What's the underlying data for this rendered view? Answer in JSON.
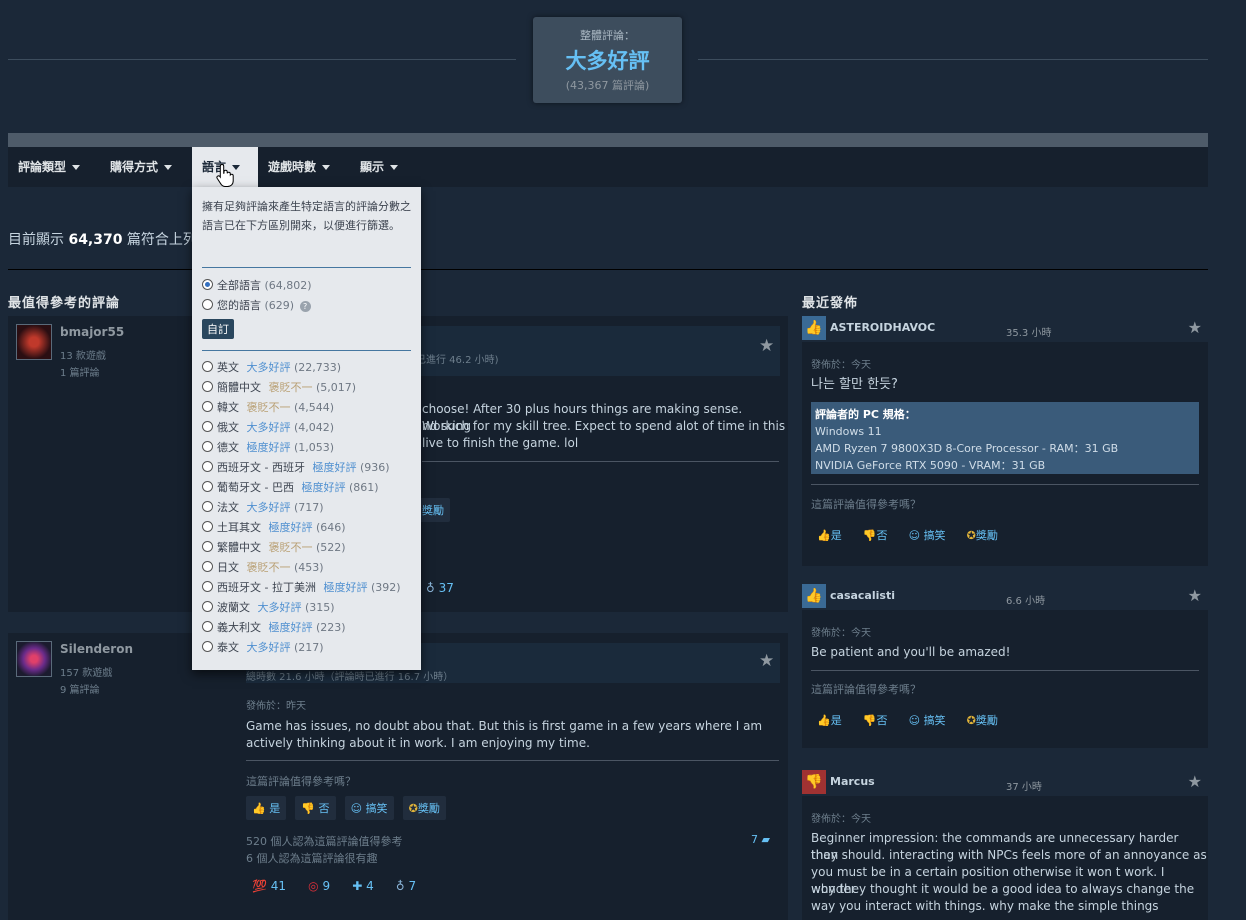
{
  "summary": {
    "label": "整體評論：",
    "rating": "大多好評",
    "count": "(43,367 篇評論)"
  },
  "filters": [
    {
      "label": "評論類型"
    },
    {
      "label": "購得方式"
    },
    {
      "label": "語言"
    },
    {
      "label": "遊戲時數"
    },
    {
      "label": "顯示"
    }
  ],
  "showing": {
    "prefix": "目前顯示 ",
    "count": "64,370",
    "suffix": " 篇符合上列"
  },
  "sections": {
    "helpful": "最值得參考的評論",
    "recent": "最近發佈"
  },
  "dropdown": {
    "description": "擁有足夠評論來產生特定語言的評論分數之語言已在下方區別開來，以便進行篩選。",
    "all_languages": "全部語言",
    "all_count": "(64,802)",
    "your_languages": "您的語言",
    "your_count": "(629)",
    "help_icon": "?",
    "custom_button": "自訂",
    "languages": [
      {
        "name": "英文",
        "rating": "大多好評",
        "type": "pos",
        "count": "(22,733)"
      },
      {
        "name": "簡體中文",
        "rating": "褒貶不一",
        "type": "mix",
        "count": "(5,017)"
      },
      {
        "name": "韓文",
        "rating": "褒貶不一",
        "type": "mix",
        "count": "(4,544)"
      },
      {
        "name": "俄文",
        "rating": "大多好評",
        "type": "pos",
        "count": "(4,042)"
      },
      {
        "name": "德文",
        "rating": "極度好評",
        "type": "pos",
        "count": "(1,053)"
      },
      {
        "name": "西班牙文 - 西班牙",
        "rating": "極度好評",
        "type": "pos",
        "count": "(936)"
      },
      {
        "name": "葡萄牙文 - 巴西",
        "rating": "極度好評",
        "type": "pos",
        "count": "(861)"
      },
      {
        "name": "法文",
        "rating": "大多好評",
        "type": "pos",
        "count": "(717)"
      },
      {
        "name": "土耳其文",
        "rating": "極度好評",
        "type": "pos",
        "count": "(646)"
      },
      {
        "name": "繁體中文",
        "rating": "褒貶不一",
        "type": "mix",
        "count": "(522)"
      },
      {
        "name": "日文",
        "rating": "褒貶不一",
        "type": "mix",
        "count": "(453)"
      },
      {
        "name": "西班牙文 - 拉丁美洲",
        "rating": "極度好評",
        "type": "pos",
        "count": "(392)"
      },
      {
        "name": "波蘭文",
        "rating": "大多好評",
        "type": "pos",
        "count": "(315)"
      },
      {
        "name": "義大利文",
        "rating": "極度好評",
        "type": "pos",
        "count": "(223)"
      },
      {
        "name": "泰文",
        "rating": "大多好評",
        "type": "pos",
        "count": "(217)"
      }
    ]
  },
  "helpful_reviews": [
    {
      "name": "bmajor55",
      "games": "13 款遊戲",
      "reviews": "1 篇評論",
      "hours": "已進行 46.2 小時)",
      "text": [
        "choose! After 30 plus hours things are making sense. Working",
        "nd such for my skill tree. Expect to spend alot of time in this",
        "live to finish the game. lol"
      ],
      "award_btn": "獎勵",
      "award_count": "37"
    },
    {
      "name": "Silenderon",
      "games": "157 款遊戲",
      "reviews": "9 篇評論",
      "hours": "總時數 21.6 小時（評論時已進行 16.7 小時）",
      "posted": "發佈於：昨天",
      "text": [
        "Game has issues, no doubt abou that. But this is first game in a few years where I am",
        "actively thinking about it in work. I am enjoying my time."
      ],
      "question": "這篇評論值得參考嗎？",
      "yes": "是",
      "no": "否",
      "funny": "搞笑",
      "award": "獎勵",
      "helpful_count": "520 個人認為這篇評論值得參考",
      "funny_count": "6 個人認為這篇評論很有趣",
      "comments": "7",
      "awards": [
        "41",
        "9",
        "4",
        "7"
      ]
    }
  ],
  "recent_reviews": [
    {
      "name": "ASTEROIDHAVOC",
      "hours": "35.3 小時",
      "posted": "發佈於：今天",
      "text": "나는 할만 한듯?",
      "specs_title": "評論者的 PC 規格：",
      "specs": [
        "Windows 11",
        "AMD Ryzen 7 9800X3D 8-Core Processor - RAM：31 GB",
        "NVIDIA GeForce RTX 5090 - VRAM：31 GB"
      ],
      "question": "這篇評論值得參考嗎？",
      "yes": "是",
      "no": "否",
      "funny": "搞笑",
      "award": "獎勵"
    },
    {
      "name": "casacalisti",
      "hours": "6.6 小時",
      "posted": "發佈於：今天",
      "text": "Be patient and you'll be amazed!",
      "question": "這篇評論值得參考嗎？",
      "yes": "是",
      "no": "否",
      "funny": "搞笑",
      "award": "獎勵"
    },
    {
      "name": "Marcus",
      "hours": "37 小時",
      "posted": "發佈於：今天",
      "text": [
        "Beginner impression: the commands are unnecessary harder than",
        "they should. interacting with NPCs feels more of an annoyance as",
        "you must be in a certain position otherwise it won t work. I wonder",
        "why they thought it would be a good idea to always change the",
        "way you interact with things. why make the simple things"
      ]
    }
  ],
  "colors": {
    "background": "#1b2838",
    "accent": "#66c0f4",
    "positive": "#4e8fd0",
    "mixed": "#b9a074",
    "negative": "#c0392b"
  }
}
